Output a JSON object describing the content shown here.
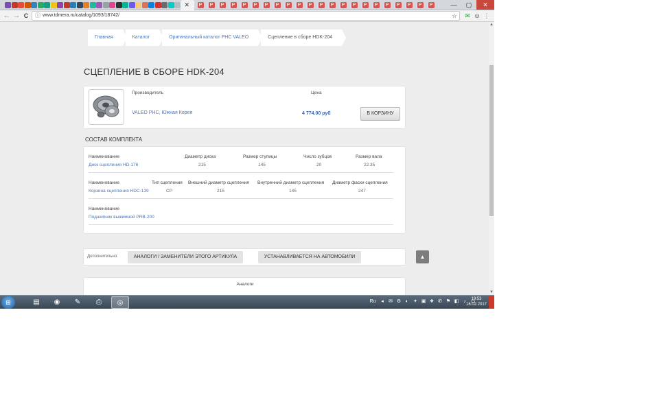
{
  "browser": {
    "url": "www.tdmera.ru/catalog/1093/18742/",
    "tab_favicons": [
      "#7d4bb5",
      "#c0392b",
      "#e74c3c",
      "#d35400",
      "#2e86c1",
      "#27ae60",
      "#16a085",
      "#f1c40f",
      "#8e44ad",
      "#c0392b",
      "#2980b9",
      "#34495e",
      "#e67e22",
      "#1abc9c",
      "#9b59b6",
      "#95a5a6",
      "#e84393",
      "#2d3436",
      "#00b894",
      "#6c5ce7",
      "#fdcb6e",
      "#e17055",
      "#0984e3",
      "#d63031",
      "#636e72",
      "#00cec9",
      "#b2bec3"
    ],
    "active_tab_symbol": "✕",
    "ext_tabs_count": 22,
    "ext_tab_color": "#d9534f",
    "ext_tab_letter": "P",
    "window_controls": {
      "minimize": "—",
      "maximize": "▢",
      "close": "✕"
    },
    "nav": {
      "back": "←",
      "forward": "→",
      "reload": "C"
    },
    "icons": {
      "lock": "ⓘ",
      "star": "☆",
      "ext1": "✉",
      "ext2": "⊖",
      "menu": "⋮"
    }
  },
  "breadcrumb": [
    {
      "label": "Главная"
    },
    {
      "label": "Каталог"
    },
    {
      "label": "Оригинальный каталог PHC VALEO"
    },
    {
      "label": "Сцепление в сборе HDK-204"
    }
  ],
  "page_title": "СЦЕПЛЕНИЕ В СБОРЕ HDK-204",
  "product": {
    "manufacturer_header": "Производитель",
    "price_header": "Цена",
    "manufacturer": "VALEO PHC, Южная Корея",
    "price": "4 774.00 руб",
    "cart_button": "В КОРЗИНУ"
  },
  "kit": {
    "title": "СОСТАВ КОМПЛЕКТА",
    "items": [
      {
        "headers": [
          "Наименование",
          "Диаметр диска",
          "Размер ступицы",
          "Число зубцов",
          "Размер вала"
        ],
        "values": [
          "Диск сцепления HD-176",
          "215",
          "145",
          "20",
          "22.35"
        ]
      },
      {
        "headers": [
          "Наименование",
          "Тип сцепления",
          "Внешний диаметр сцепления",
          "Внутренний диаметр сцепления",
          "Диаметр фаски сцепления"
        ],
        "values": [
          "Корзина сцепления HDC-139",
          "CP",
          "215",
          "145",
          "247"
        ]
      },
      {
        "headers": [
          "Наименование"
        ],
        "values": [
          "Подшипник выжимной PRB-200"
        ]
      }
    ]
  },
  "extra": {
    "label": "Дополнительно:",
    "analogs_button": "АНАЛОГИ / ЗАМЕНИТЕЛИ ЭТОГО АРТИКУЛА",
    "cars_button": "УСТАНАВЛИВАЕТСЯ НА АВТОМОБИЛИ",
    "scroll_top_symbol": "▲"
  },
  "analogs": {
    "title": "Аналоги"
  },
  "taskbar": {
    "start_symbol": "⊞",
    "apps": [
      {
        "name": "explorer",
        "symbol": "▤"
      },
      {
        "name": "media",
        "symbol": "◉"
      },
      {
        "name": "tool",
        "symbol": "✎"
      },
      {
        "name": "printer",
        "symbol": "⎙"
      },
      {
        "name": "chrome",
        "symbol": "◎"
      }
    ],
    "language": "Ru",
    "tray_symbols": [
      "◂",
      "✉",
      "⚙",
      "◐",
      "✦",
      "▣",
      "❖",
      "✆",
      "⚑",
      "◧",
      "♪",
      "▭"
    ],
    "time": "19:53",
    "date": "16.02.2017"
  }
}
